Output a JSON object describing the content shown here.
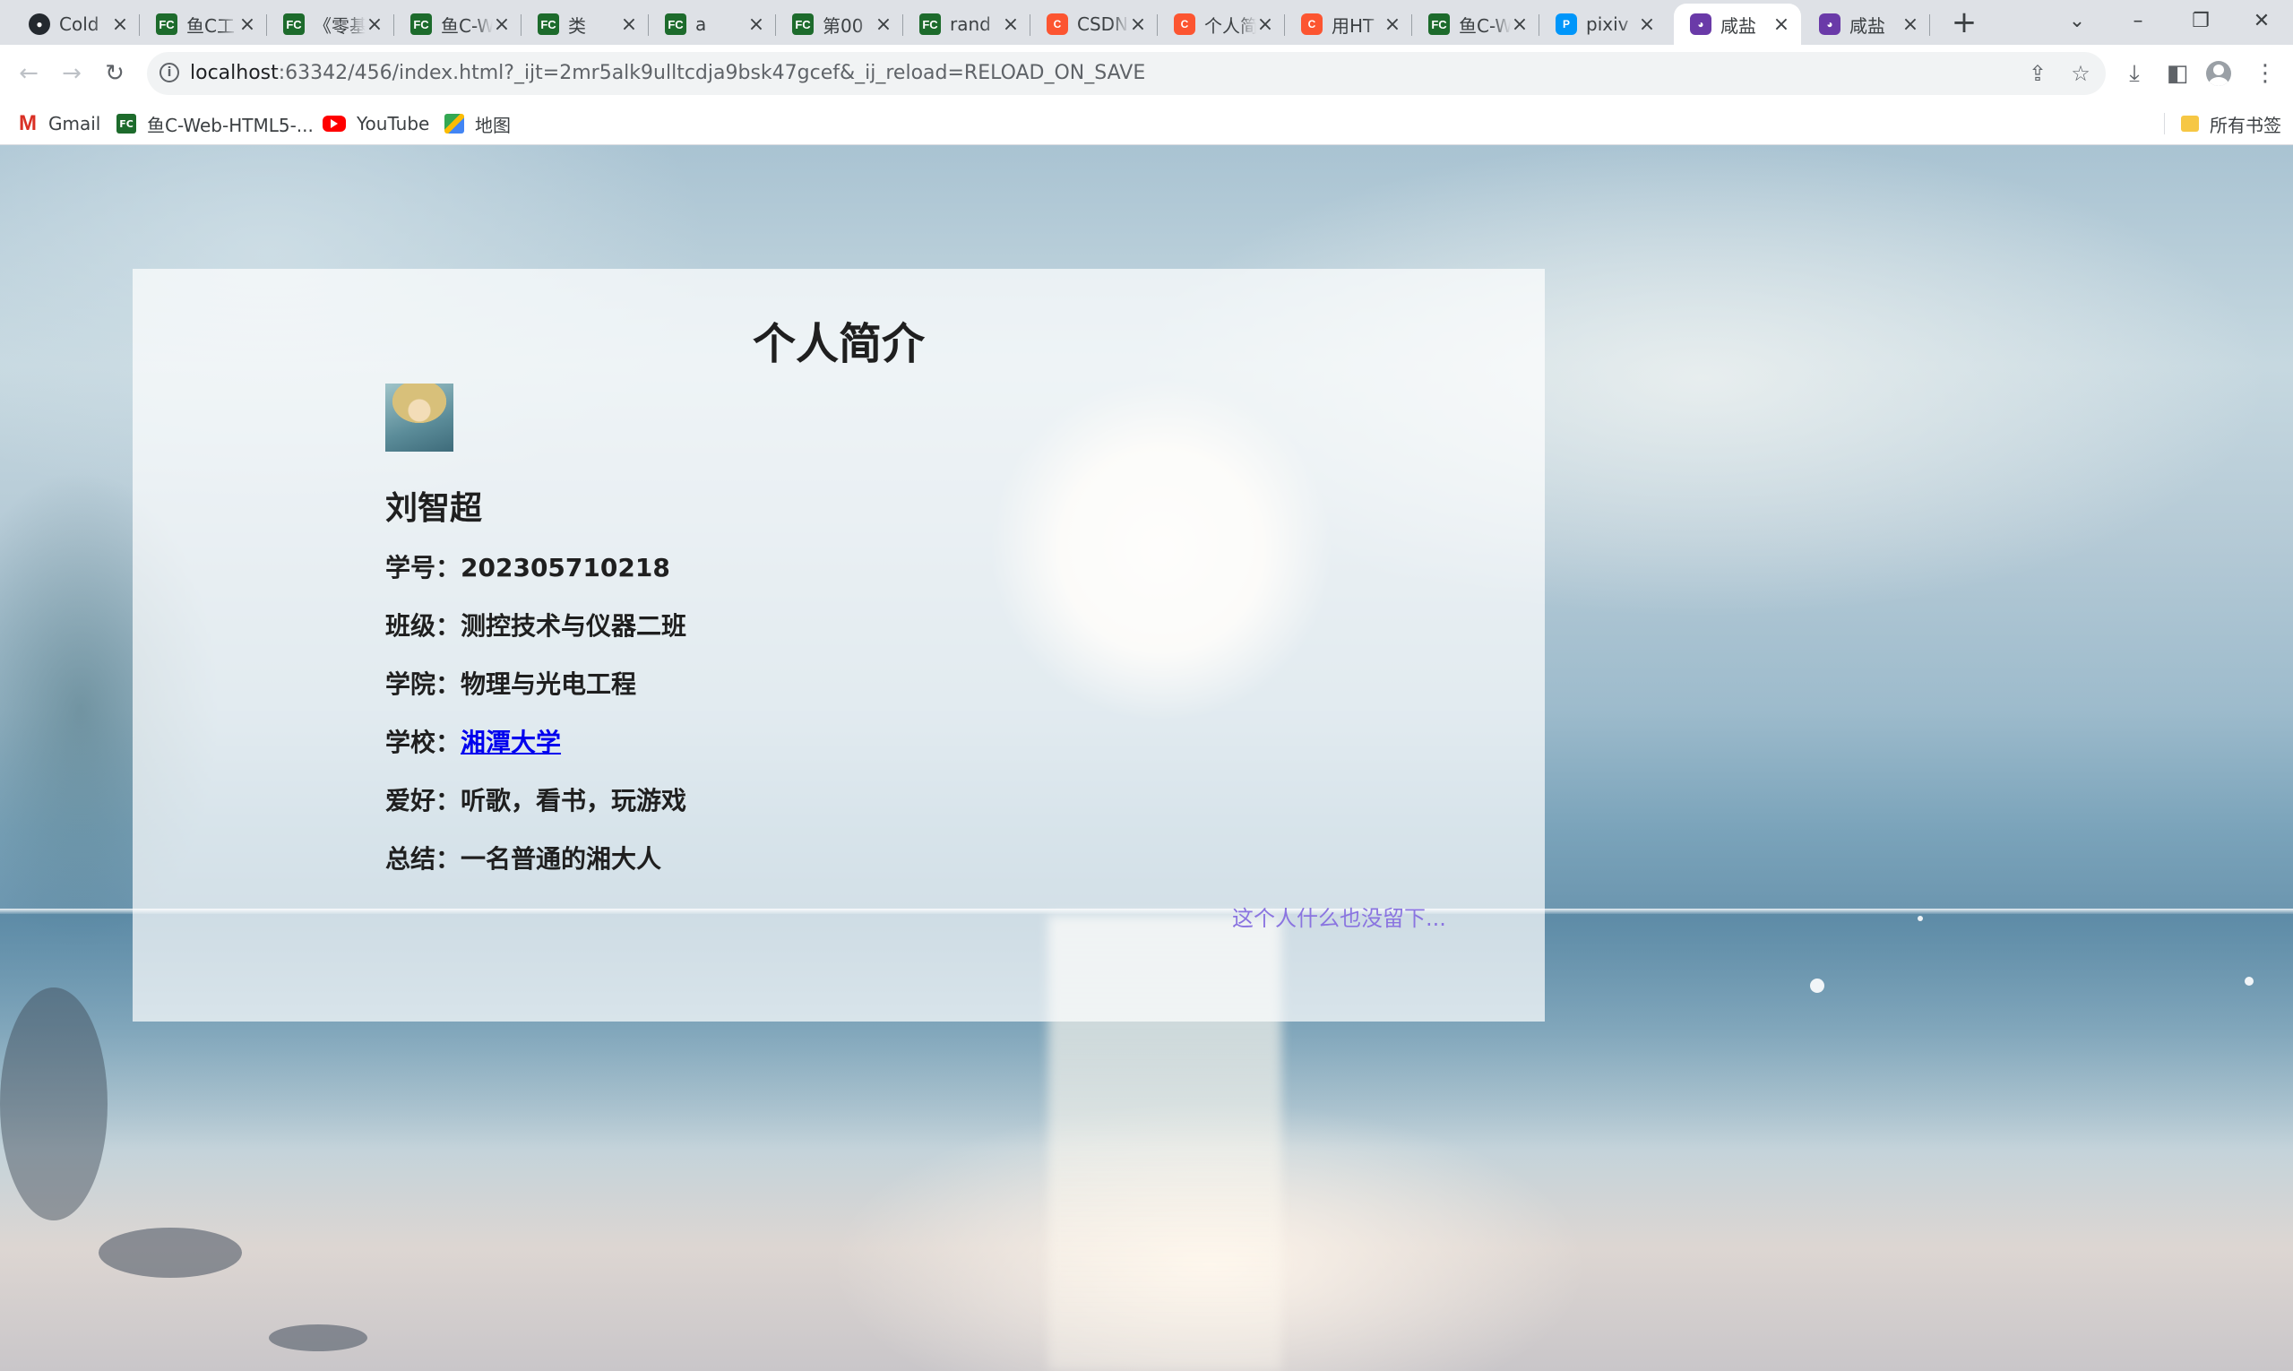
{
  "browser": {
    "tabs": [
      {
        "title": "Cold",
        "favicon": "github-icon"
      },
      {
        "title": "鱼C工",
        "favicon": "fishc-icon"
      },
      {
        "title": "《零基",
        "favicon": "fishc-icon"
      },
      {
        "title": "鱼C-W",
        "favicon": "fishc-icon"
      },
      {
        "title": "类",
        "favicon": "fishc-icon"
      },
      {
        "title": "a",
        "favicon": "fishc-icon"
      },
      {
        "title": "第00",
        "favicon": "fishc-icon"
      },
      {
        "title": "rand",
        "favicon": "fishc-icon"
      },
      {
        "title": "CSDN",
        "favicon": "csdn-icon"
      },
      {
        "title": "个人简",
        "favicon": "csdn-icon"
      },
      {
        "title": "用HT",
        "favicon": "csdn-icon"
      },
      {
        "title": "鱼C-W",
        "favicon": "fishc-icon"
      },
      {
        "title": "pixiv",
        "favicon": "pixiv-icon"
      },
      {
        "title": "咸盐",
        "favicon": "salt-icon",
        "active": true
      },
      {
        "title": "咸盐",
        "favicon": "salt-icon"
      }
    ],
    "url_host": "localhost",
    "url_rest": ":63342/456/index.html?_ijt=2mr5alk9ulltcdja9bsk47gcef&_ij_reload=RELOAD_ON_SAVE",
    "bookmarks": [
      {
        "label": "Gmail",
        "icon": "gmail-icon"
      },
      {
        "label": "鱼C-Web-HTML5-...",
        "icon": "fishc-icon"
      },
      {
        "label": "YouTube",
        "icon": "youtube-icon"
      },
      {
        "label": "地图",
        "icon": "maps-icon"
      }
    ],
    "all_bookmarks_label": "所有书签"
  },
  "page": {
    "title": "个人简介",
    "name": "刘智超",
    "rows": [
      {
        "label": "学号：",
        "value": "202305710218"
      },
      {
        "label": "班级：",
        "value": "测控技术与仪器二班"
      },
      {
        "label": "学院：",
        "value": "物理与光电工程"
      },
      {
        "label": "学校：",
        "value": "湘潭大学",
        "link": true
      },
      {
        "label": "爱好：",
        "value": "听歌，看书，玩游戏"
      },
      {
        "label": "总结：",
        "value": "一名普通的湘大人"
      }
    ],
    "footnote": "这个人什么也没留下..."
  },
  "colors": {
    "link": "#0000ee",
    "footnote": "#8a74e0",
    "card_background": "rgba(255,255,255,0.7)"
  }
}
